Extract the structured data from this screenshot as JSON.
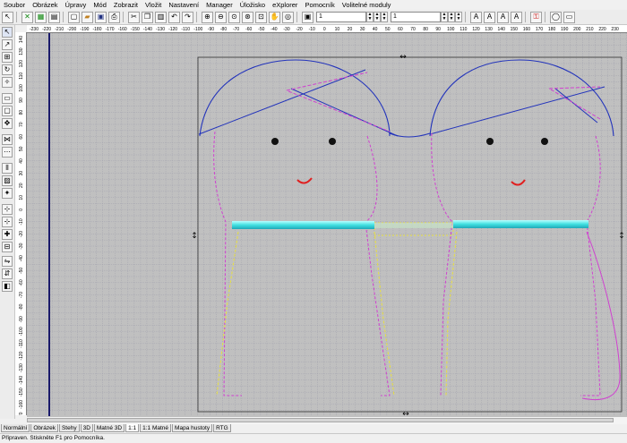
{
  "menu": [
    "Soubor",
    "Obrázek",
    "Úpravy",
    "Mód",
    "Zobrazit",
    "Vložit",
    "Nastavení",
    "Manager",
    "Úložisko",
    "eXplorer",
    "Pomocník",
    "Volitelné moduly"
  ],
  "toolbar": {
    "field_1": "1",
    "field_2": "1",
    "icons": [
      "cursor-icon",
      "stitch-icon",
      "grid-icon",
      "new-icon",
      "open-icon",
      "save-icon",
      "cut-icon",
      "copy-icon",
      "paste-icon",
      "undo-icon",
      "redo-icon",
      "zoom-in-icon",
      "zoom-out-icon",
      "zoom-fit-icon",
      "zoom-all-icon",
      "hoop-icon",
      "text-a-icon",
      "text-a2-icon",
      "text-a3-icon",
      "text-a4-icon",
      "key-icon",
      "fill-icon",
      "display-icon"
    ]
  },
  "ruler_top_labels": [
    "-230",
    "-220",
    "-210",
    "-200",
    "-190",
    "-180",
    "-170",
    "-160",
    "-150",
    "-140",
    "-130",
    "-120",
    "-110",
    "-100",
    "-90",
    "-80",
    "-70",
    "-60",
    "-50",
    "-40",
    "-30",
    "-20",
    "-10",
    "0",
    "10",
    "20",
    "30",
    "40",
    "50",
    "60",
    "70",
    "80",
    "90",
    "100",
    "110",
    "120",
    "130",
    "140",
    "150",
    "160",
    "170",
    "180",
    "190",
    "200",
    "210",
    "220",
    "230"
  ],
  "ruler_left_labels": [
    "140",
    "130",
    "120",
    "110",
    "100",
    "90",
    "80",
    "70",
    "60",
    "50",
    "40",
    "30",
    "20",
    "10",
    "0",
    "-10",
    "-20",
    "-30",
    "-40",
    "-50",
    "-60",
    "-70",
    "-80",
    "-90",
    "-100",
    "-110",
    "-120",
    "-130",
    "-140",
    "-150",
    "-160",
    "-170"
  ],
  "tabs": [
    "Normální",
    "Obrázek",
    "Stehy",
    "3D",
    "Matné 3D",
    "1:1",
    "1:1 Matné",
    "Mapa hustoty",
    "RTG"
  ],
  "active_tab": "1:1",
  "status": "Připraven. Stiskněte F1 pro Pomocníka.",
  "colors": {
    "canvas_bg": "#c0c0c0",
    "grid_major": "#9a9aa8",
    "outline_blue": "#2233bb",
    "stitch_magenta": "#d040d0",
    "stitch_yellow": "#e8e040",
    "bar_cyan": "#40e0e0",
    "mouth_red": "#e02020",
    "hoop_line": "#1a1a6a"
  }
}
